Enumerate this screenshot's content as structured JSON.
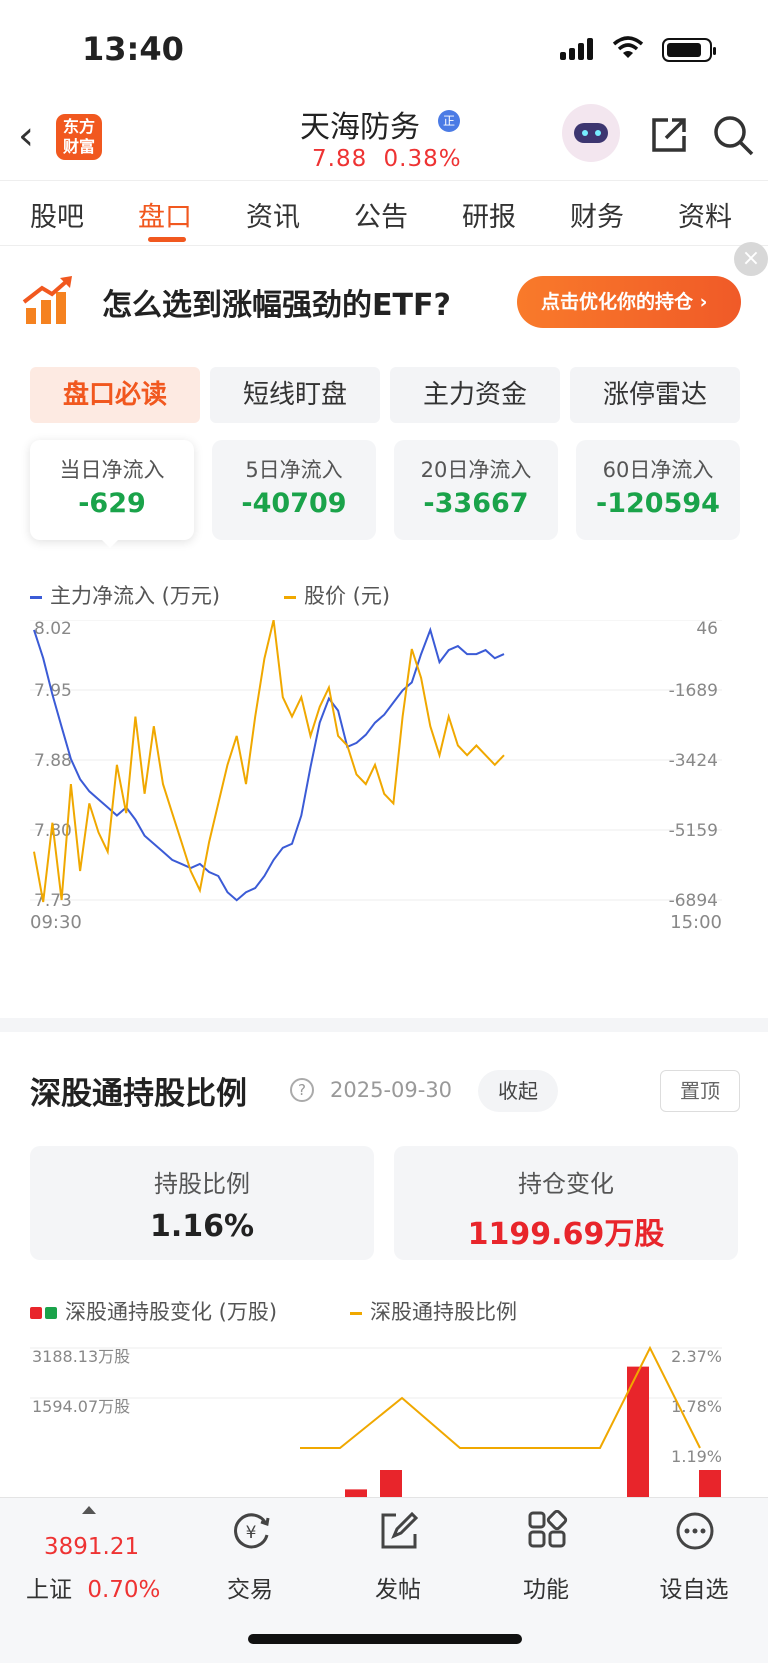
{
  "status_bar": {
    "time": "13:40"
  },
  "header": {
    "logo_text": "东方财富",
    "stock_name": "天海防务",
    "badge": "正",
    "price": "7.88",
    "change_pct": "0.38%"
  },
  "tabs": [
    "股吧",
    "盘口",
    "资讯",
    "公告",
    "研报",
    "财务",
    "资料"
  ],
  "banner": {
    "text": "怎么选到涨幅强劲的ETF?",
    "button": "点击优化你的持仓 ›",
    "close": "×"
  },
  "subtabs": [
    "盘口必读",
    "短线盯盘",
    "主力资金",
    "涨停雷达"
  ],
  "flows": [
    {
      "label": "当日净流入",
      "value": "-629"
    },
    {
      "label": "5日净流入",
      "value": "-40709"
    },
    {
      "label": "20日净流入",
      "value": "-33667"
    },
    {
      "label": "60日净流入",
      "value": "-120594"
    }
  ],
  "chart_data": [
    {
      "type": "line",
      "legend": [
        "主力净流入 (万元)",
        "股价 (元)"
      ],
      "left_axis_labels": [
        "8.02",
        "7.95",
        "7.88",
        "7.80",
        "7.73"
      ],
      "right_axis_labels": [
        "46",
        "-1689",
        "-3424",
        "-5159",
        "-6894"
      ],
      "x_labels": [
        "09:30",
        "15:00"
      ],
      "ylim_price": [
        7.73,
        8.02
      ],
      "ylim_flow": [
        -6894,
        46
      ],
      "series": [
        {
          "name": "主力净流入 (万元)",
          "color": "#3b5bd6",
          "values": [
            -200,
            -900,
            -1800,
            -2600,
            -3400,
            -3900,
            -4200,
            -4400,
            -4600,
            -4800,
            -4600,
            -4900,
            -5300,
            -5500,
            -5700,
            -5900,
            -6000,
            -6100,
            -6000,
            -6200,
            -6300,
            -6700,
            -6900,
            -6700,
            -6600,
            -6300,
            -5900,
            -5600,
            -5500,
            -4800,
            -3600,
            -2500,
            -1900,
            -2200,
            -3100,
            -3000,
            -2800,
            -2500,
            -2300,
            -2000,
            -1700,
            -1500,
            -800,
            -200,
            -1000,
            -700,
            -600,
            -800,
            -800,
            -700,
            -900,
            -800
          ]
        },
        {
          "name": "股价 (元)",
          "color": "#f0a800",
          "values": [
            7.78,
            7.72,
            7.81,
            7.73,
            7.85,
            7.76,
            7.83,
            7.8,
            7.78,
            7.87,
            7.82,
            7.92,
            7.84,
            7.91,
            7.85,
            7.82,
            7.79,
            7.76,
            7.74,
            7.79,
            7.83,
            7.87,
            7.9,
            7.85,
            7.92,
            7.98,
            8.02,
            7.94,
            7.92,
            7.94,
            7.9,
            7.93,
            7.95,
            7.9,
            7.89,
            7.86,
            7.85,
            7.87,
            7.84,
            7.83,
            7.92,
            7.99,
            7.96,
            7.91,
            7.88,
            7.92,
            7.89,
            7.88,
            7.89,
            7.88,
            7.87,
            7.88
          ]
        }
      ]
    },
    {
      "type": "bar",
      "legend": [
        "深股通持股变化 (万股)",
        "深股通持股比例"
      ],
      "left_axis_labels": [
        "3188.13万股",
        "1594.07万股"
      ],
      "right_axis_labels": [
        "2.37%",
        "1.78%",
        "1.19%"
      ],
      "bars_ylim": [
        0,
        3188.13
      ],
      "ratio_ylim": [
        1.19,
        2.37
      ],
      "bars": [
        {
          "value": 1000,
          "color": "#e8252b"
        },
        {
          "value": 1300,
          "color": "#e8252b"
        },
        {
          "value": 500,
          "color": "#e8252b"
        },
        {
          "value": 2900,
          "color": "#e8252b"
        },
        {
          "value": 1300,
          "color": "#e8252b"
        }
      ],
      "ratio_points": [
        1.19,
        1.19,
        1.78,
        1.19,
        1.19,
        1.19,
        2.37,
        1.19
      ]
    }
  ],
  "holding": {
    "title": "深股通持股比例",
    "help": "?",
    "date": "2025-09-30",
    "collapse": "收起",
    "pin": "置顶",
    "ratio_label": "持股比例",
    "ratio_value": "1.16%",
    "change_label": "持仓变化",
    "change_value": "1199.69万股"
  },
  "bottom_bar": {
    "index_value": "3891.21",
    "index_name": "上证",
    "index_change": "0.70%",
    "items": [
      "交易",
      "发帖",
      "功能",
      "设自选"
    ]
  },
  "colors": {
    "accent": "#f1581f",
    "up": "#e33",
    "down": "#1aa34a"
  }
}
